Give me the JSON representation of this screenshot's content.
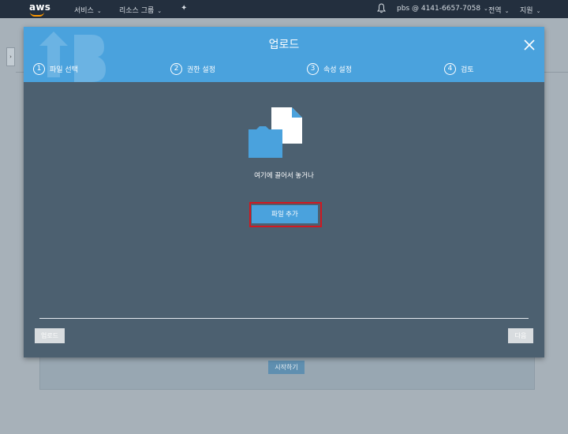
{
  "topnav": {
    "logo": "aws",
    "services": "서비스",
    "resource_groups": "리소스 그룹",
    "account": "pbs @ 4141-6657-7058",
    "region": "전역",
    "support": "지원"
  },
  "modal": {
    "title": "업로드",
    "steps": [
      {
        "num": "1",
        "label": "파일 선택",
        "active": true
      },
      {
        "num": "2",
        "label": "권한 설정",
        "active": false
      },
      {
        "num": "3",
        "label": "속성 설정",
        "active": false
      },
      {
        "num": "4",
        "label": "검토",
        "active": false
      }
    ],
    "drop_text": "여기에 끌어서 놓거나",
    "add_file": "파일 추가",
    "upload_btn": "업로드",
    "next_btn": "다음"
  },
  "background": {
    "start_btn": "시작하기"
  },
  "colors": {
    "header_blue": "#4aa2dd",
    "modal_body": "#4c6070",
    "nav_bg": "#232f3e",
    "highlight": "#d01820"
  }
}
